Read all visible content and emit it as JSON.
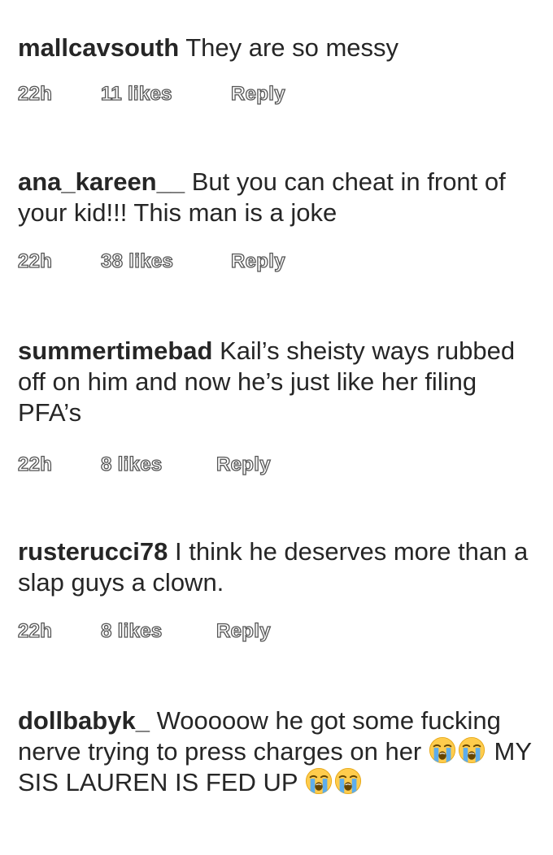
{
  "comments": [
    {
      "username": "mallcavsouth",
      "text": "They are so messy",
      "time": "22h",
      "likes": "11 likes",
      "reply": "Reply"
    },
    {
      "username": "ana_kareen__",
      "text": "But you can cheat in front of your kid!!! This man is a joke",
      "time": "22h",
      "likes": "38 likes",
      "reply": "Reply"
    },
    {
      "username": "summertimebad",
      "text": "Kail’s sheisty ways rubbed off on him and now he’s just like her filing PFA’s",
      "time": "22h",
      "likes": "8 likes",
      "reply": "Reply"
    },
    {
      "username": "rusterucci78",
      "text": "I think he deserves more than a slap guys a clown.",
      "time": "22h",
      "likes": "8 likes",
      "reply": "Reply"
    },
    {
      "username": "dollbabyk_",
      "text_part1": "Wooooow he got some fucking nerve trying to press charges on her",
      "text_part2": "MY SIS LAUREN IS FED UP",
      "emoji_name": "loudly-crying-face-icon"
    }
  ]
}
